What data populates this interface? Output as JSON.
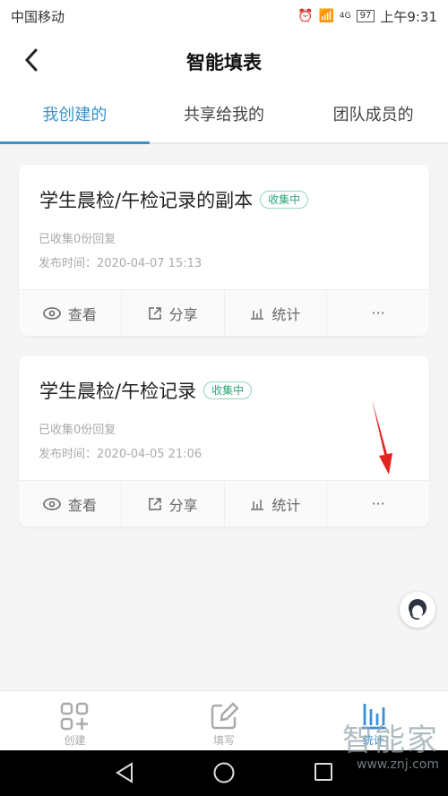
{
  "status_bar": {
    "carrier": "中国移动",
    "battery": "97",
    "network": "4G",
    "time": "上午9:31"
  },
  "header": {
    "title": "智能填表",
    "back_icon": "chevron-left-icon"
  },
  "tabs": [
    {
      "label": "我创建的",
      "active": true
    },
    {
      "label": "共享给我的",
      "active": false
    },
    {
      "label": "团队成员的",
      "active": false
    }
  ],
  "cards": [
    {
      "title": "学生晨检/午检记录的副本",
      "badge": "收集中",
      "replies": "已收集0份回复",
      "published": "发布时间：2020-04-07 15:13"
    },
    {
      "title": "学生晨检/午检记录",
      "badge": "收集中",
      "replies": "已收集0份回复",
      "published": "发布时间：2020-04-05 21:06"
    }
  ],
  "card_actions": {
    "view": "查看",
    "share": "分享",
    "stats": "统计",
    "more": "···"
  },
  "bottom_nav": [
    {
      "label": "创建",
      "icon": "grid-plus-icon",
      "active": false
    },
    {
      "label": "填写",
      "icon": "edit-icon",
      "active": false
    },
    {
      "label": "统计",
      "icon": "bar-chart-icon",
      "active": true
    }
  ],
  "watermark": {
    "text": "智能家",
    "url": "www.znj.com"
  },
  "colors": {
    "accent": "#3a93c9",
    "badge": "#2aa676",
    "annotation_arrow": "#e52420"
  }
}
